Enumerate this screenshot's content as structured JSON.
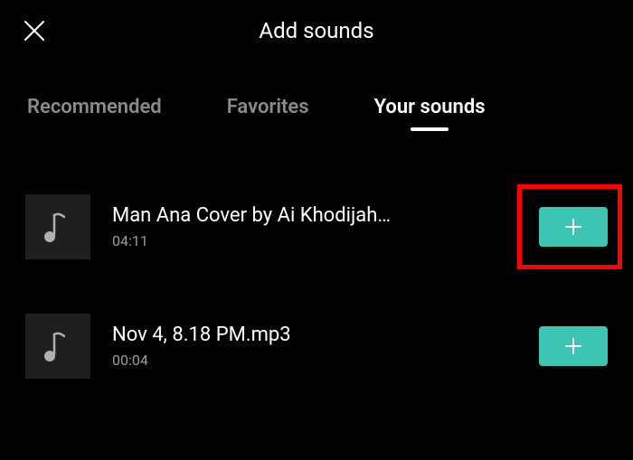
{
  "header": {
    "title": "Add sounds"
  },
  "tabs": {
    "recommended": "Recommended",
    "favorites": "Favorites",
    "your_sounds": "Your sounds"
  },
  "sounds": [
    {
      "title": "Man Ana Cover by Ai Khodijah…",
      "duration": "04:11",
      "highlighted": true
    },
    {
      "title": "Nov 4, 8.18 PM.mp3",
      "duration": "00:04",
      "highlighted": false
    }
  ]
}
